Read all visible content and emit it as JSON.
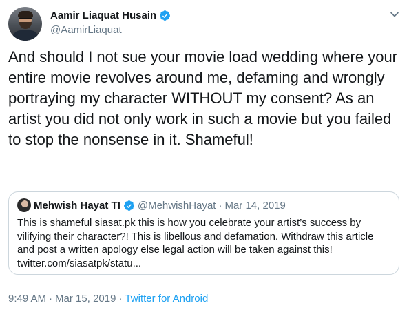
{
  "author": {
    "display_name": "Aamir Liaquat Husain",
    "handle": "@AamirLiaquat"
  },
  "tweet": {
    "text": "And should I not sue your movie load wedding where your entire movie revolves around me, defaming and wrongly portraying my character WITHOUT my consent? As an artist you did not only work in such a movie but you failed to stop the nonsense in it. Shameful!"
  },
  "quoted": {
    "display_name": "Mehwish Hayat TI",
    "handle": "@MehwishHayat",
    "separator": "·",
    "date": "Mar 14, 2019",
    "text": "This is shameful siasat.pk this is how you celebrate your artist’s success by vilifying their character?! This is libellous and defamation. Withdraw this article and post a written apology else legal action will be taken against this! twitter.com/siasatpk/statu..."
  },
  "footer": {
    "time": "9:49 AM",
    "separator1": "·",
    "date": "Mar 15, 2019",
    "separator2": "·",
    "source": "Twitter for Android"
  },
  "colors": {
    "text": "#14171a",
    "secondary": "#657786",
    "accent": "#1da1f2",
    "border": "#ccd6dd"
  },
  "icons": {
    "verified": "verified-badge-icon",
    "more": "chevron-down-icon"
  }
}
